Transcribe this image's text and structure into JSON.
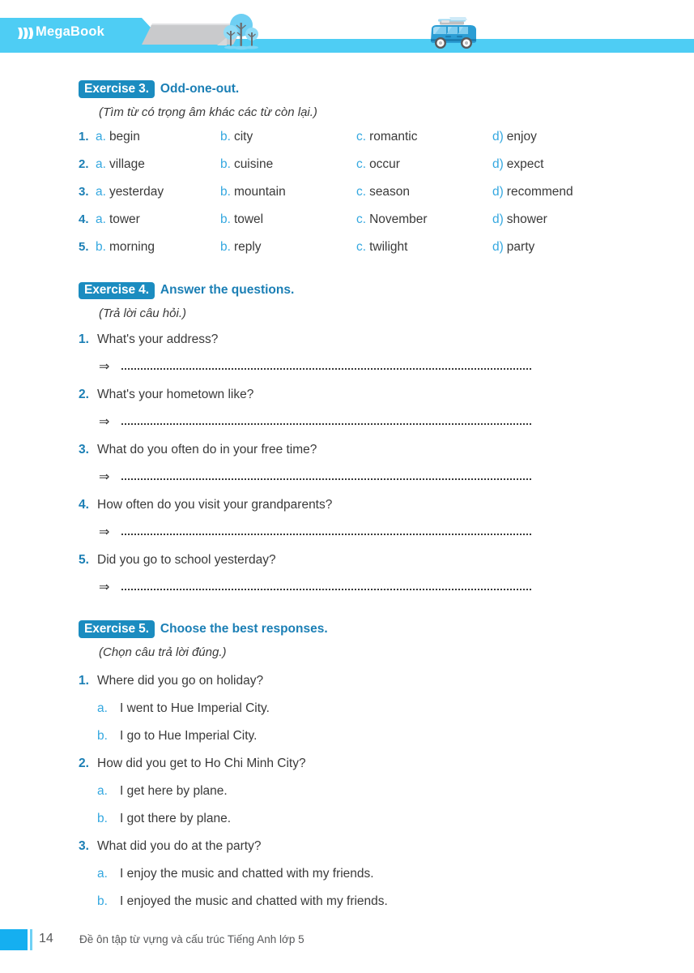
{
  "header": {
    "logo": "MegaBook",
    "logo_icon": "triple-chevron-icon",
    "tree_icon": "trees-icon",
    "car_icon": "car-with-roof-rack-icon",
    "band_color": "#4ecdf4",
    "gray_color": "#c9cacc"
  },
  "exercises": [
    {
      "badge": "Exercise 3.",
      "title": "Odd-one-out.",
      "subtitle": "(Tìm từ có trọng âm khác các từ còn lại.)",
      "type": "word-grid",
      "rows": [
        {
          "num": "1.",
          "cells": [
            {
              "letter": "a.",
              "word": "begin"
            },
            {
              "letter": "b.",
              "word": "city"
            },
            {
              "letter": "c.",
              "word": "romantic"
            },
            {
              "letter": "d)",
              "word": "enjoy"
            }
          ]
        },
        {
          "num": "2.",
          "cells": [
            {
              "letter": "a.",
              "word": "village"
            },
            {
              "letter": "b.",
              "word": "cuisine"
            },
            {
              "letter": "c.",
              "word": "occur"
            },
            {
              "letter": "d)",
              "word": "expect"
            }
          ]
        },
        {
          "num": "3.",
          "cells": [
            {
              "letter": "a.",
              "word": "yesterday"
            },
            {
              "letter": "b.",
              "word": "mountain"
            },
            {
              "letter": "c.",
              "word": "season"
            },
            {
              "letter": "d)",
              "word": "recommend"
            }
          ]
        },
        {
          "num": "4.",
          "cells": [
            {
              "letter": "a.",
              "word": "tower"
            },
            {
              "letter": "b.",
              "word": "towel"
            },
            {
              "letter": "c.",
              "word": "November"
            },
            {
              "letter": "d)",
              "word": "shower"
            }
          ]
        },
        {
          "num": "5.",
          "cells": [
            {
              "letter": "b.",
              "word": "morning"
            },
            {
              "letter": "b.",
              "word": "reply"
            },
            {
              "letter": "c.",
              "word": "twilight"
            },
            {
              "letter": "d)",
              "word": "party"
            }
          ]
        }
      ]
    },
    {
      "badge": "Exercise 4.",
      "title": "Answer the questions.",
      "subtitle": "(Trả lời câu hỏi.)",
      "type": "answer-lines",
      "arrow": "⇒",
      "questions": [
        {
          "num": "1.",
          "text": "What's your address?"
        },
        {
          "num": "2.",
          "text": "What's your hometown like?"
        },
        {
          "num": "3.",
          "text": "What do you often do in your free time?"
        },
        {
          "num": "4.",
          "text": "How often do you visit your grandparents?"
        },
        {
          "num": "5.",
          "text": "Did you go to school yesterday?"
        }
      ]
    },
    {
      "badge": "Exercise 5.",
      "title": "Choose the best responses.",
      "subtitle": "(Chọn câu trả lời đúng.)",
      "type": "multiple-choice",
      "questions": [
        {
          "num": "1.",
          "text": "Where did you go on holiday?",
          "options": [
            {
              "letter": "a.",
              "text": "I went to Hue Imperial City."
            },
            {
              "letter": "b.",
              "text": "I go to Hue Imperial City."
            }
          ]
        },
        {
          "num": "2.",
          "text": "How did you get to Ho Chi Minh City?",
          "options": [
            {
              "letter": "a.",
              "text": "I get here by plane."
            },
            {
              "letter": "b.",
              "text": "I got there by plane."
            }
          ]
        },
        {
          "num": "3.",
          "text": "What did you do at the party?",
          "options": [
            {
              "letter": "a.",
              "text": "I enjoy the music and chatted with my friends."
            },
            {
              "letter": "b.",
              "text": "I enjoyed the music and chatted with my friends."
            }
          ]
        }
      ]
    }
  ],
  "footer": {
    "page_number": "14",
    "title": "Đề ôn tập từ vựng và cấu trúc Tiếng Anh lớp 5"
  },
  "colors": {
    "badge_blue": "#1b8cc0",
    "title_blue": "#1b7fb5",
    "letter_blue": "#35a8e0",
    "header_blue": "#4ecdf4",
    "footer_blue": "#15aff0",
    "text_gray": "#3a3a3a"
  }
}
